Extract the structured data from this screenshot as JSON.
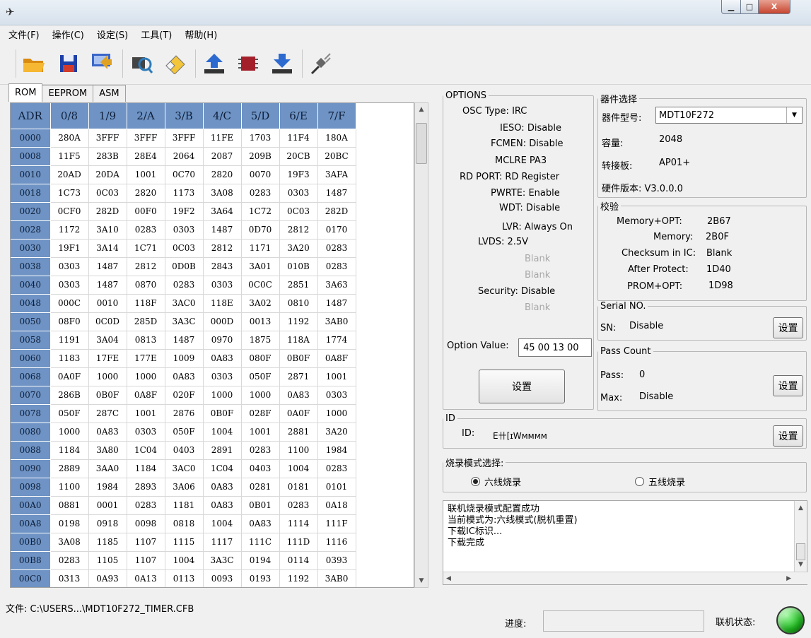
{
  "window": {
    "app_icon": "tool-icon",
    "btn_min": "▁",
    "btn_max": "□",
    "btn_close": "X"
  },
  "menu": [
    "文件(F)",
    "操作(C)",
    "设定(S)",
    "工具(T)",
    "帮助(H)"
  ],
  "toolbar_icons": [
    "open-folder-icon",
    "save-icon",
    "save-as-icon",
    "search-chip-icon",
    "erase-icon",
    "upload-icon",
    "chip-icon",
    "download-icon",
    "connect-plug-icon"
  ],
  "tabs": [
    "ROM",
    "EEPROM",
    "ASM"
  ],
  "rom": {
    "columns": [
      "ADR",
      "0/8",
      "1/9",
      "2/A",
      "3/B",
      "4/C",
      "5/D",
      "6/E",
      "7/F"
    ],
    "rows": [
      [
        "0000",
        "280A",
        "3FFF",
        "3FFF",
        "3FFF",
        "11FE",
        "1703",
        "11F4",
        "180A"
      ],
      [
        "0008",
        "11F5",
        "283B",
        "28E4",
        "2064",
        "2087",
        "209B",
        "20CB",
        "20BC"
      ],
      [
        "0010",
        "20AD",
        "20DA",
        "1001",
        "0C70",
        "2820",
        "0070",
        "19F3",
        "3AFA"
      ],
      [
        "0018",
        "1C73",
        "0C03",
        "2820",
        "1173",
        "3A08",
        "0283",
        "0303",
        "1487"
      ],
      [
        "0020",
        "0CF0",
        "282D",
        "00F0",
        "19F2",
        "3A64",
        "1C72",
        "0C03",
        "282D"
      ],
      [
        "0028",
        "1172",
        "3A10",
        "0283",
        "0303",
        "1487",
        "0D70",
        "2812",
        "0170"
      ],
      [
        "0030",
        "19F1",
        "3A14",
        "1C71",
        "0C03",
        "2812",
        "1171",
        "3A20",
        "0283"
      ],
      [
        "0038",
        "0303",
        "1487",
        "2812",
        "0D0B",
        "2843",
        "3A01",
        "010B",
        "0283"
      ],
      [
        "0040",
        "0303",
        "1487",
        "0870",
        "0283",
        "0303",
        "0C0C",
        "2851",
        "3A63"
      ],
      [
        "0048",
        "000C",
        "0010",
        "118F",
        "3AC0",
        "118E",
        "3A02",
        "0810",
        "1487"
      ],
      [
        "0050",
        "08F0",
        "0C0D",
        "285D",
        "3A3C",
        "000D",
        "0013",
        "1192",
        "3AB0"
      ],
      [
        "0058",
        "1191",
        "3A04",
        "0813",
        "1487",
        "0970",
        "1875",
        "118A",
        "1774"
      ],
      [
        "0060",
        "1183",
        "17FE",
        "177E",
        "1009",
        "0A83",
        "080F",
        "0B0F",
        "0A8F"
      ],
      [
        "0068",
        "0A0F",
        "1000",
        "1000",
        "0A83",
        "0303",
        "050F",
        "2871",
        "1001"
      ],
      [
        "0070",
        "286B",
        "0B0F",
        "0A8F",
        "020F",
        "1000",
        "1000",
        "0A83",
        "0303"
      ],
      [
        "0078",
        "050F",
        "287C",
        "1001",
        "2876",
        "0B0F",
        "028F",
        "0A0F",
        "1000"
      ],
      [
        "0080",
        "1000",
        "0A83",
        "0303",
        "050F",
        "1004",
        "1001",
        "2881",
        "3A20"
      ],
      [
        "0088",
        "1184",
        "3A80",
        "1C04",
        "0403",
        "2891",
        "0283",
        "1100",
        "1984"
      ],
      [
        "0090",
        "2889",
        "3AA0",
        "1184",
        "3AC0",
        "1C04",
        "0403",
        "1004",
        "0283"
      ],
      [
        "0098",
        "1100",
        "1984",
        "2893",
        "3A06",
        "0A83",
        "0281",
        "0181",
        "0101"
      ],
      [
        "00A0",
        "0881",
        "0001",
        "0283",
        "1181",
        "0A83",
        "0B01",
        "0283",
        "0A18"
      ],
      [
        "00A8",
        "0198",
        "0918",
        "0098",
        "0818",
        "1004",
        "0A83",
        "1114",
        "111F"
      ],
      [
        "00B0",
        "3A08",
        "1185",
        "1107",
        "1115",
        "1117",
        "111C",
        "111D",
        "1116"
      ],
      [
        "00B8",
        "0283",
        "1105",
        "1107",
        "1004",
        "3A3C",
        "0194",
        "0114",
        "0393"
      ],
      [
        "00C0",
        "0313",
        "0A93",
        "0A13",
        "0113",
        "0093",
        "0193",
        "1192",
        "3AB0"
      ]
    ]
  },
  "file_path": "文件: C:\\USERS...\\MDT10F272_TIMER.CFB",
  "options": {
    "legend": "OPTIONS",
    "osc_type": "OSC Type: IRC",
    "ieso": "IESO: Disable",
    "fcmen": "FCMEN: Disable",
    "mclre": "MCLRE PA3",
    "rd_port": "RD PORT: RD Register",
    "pwrte": "PWRTE: Enable",
    "wdt": "WDT: Disable",
    "lvr": "LVR: Always On",
    "lvds": "LVDS: 2.5V",
    "blank1": "Blank",
    "blank2": "Blank",
    "security": "Security: Disable",
    "blank3": "Blank",
    "option_value_label": "Option Value:",
    "option_value": "45 00 13 00",
    "set_label": "设置"
  },
  "device": {
    "legend": "器件选择",
    "model_label": "器件型号:",
    "model_value": "MDT10F272",
    "capacity_label": "容量:",
    "capacity_value": "2048",
    "adapter_label": "转接板:",
    "adapter_value": "AP01+",
    "hw_version": "硬件版本: V3.0.0.0"
  },
  "checksum": {
    "legend": "校验",
    "mem_opt_label": "Memory+OPT:",
    "mem_opt_value": "2B67",
    "memory_label": "Memory:",
    "memory_value": "2B0F",
    "in_ic_label": "Checksum in IC:",
    "in_ic_value": "Blank",
    "after_label": "After Protect:",
    "after_value": "1D40",
    "prom_label": "PROM+OPT:",
    "prom_value": "1D98"
  },
  "serial": {
    "legend": "Serial NO.",
    "sn_label": "SN:",
    "sn_value": "Disable",
    "set_label": "设置"
  },
  "pass": {
    "legend": "Pass Count",
    "pass_label": "Pass:",
    "pass_value": "0",
    "max_label": "Max:",
    "max_value": "Disable",
    "set_label": "设置"
  },
  "id": {
    "legend": "ID",
    "id_label": "ID:",
    "id_value": "E卄[ɪWᴍᴍᴍᴍ",
    "set_label": "设置"
  },
  "burn_mode": {
    "legend": "烧录模式选择:",
    "six_wire": "六线烧录",
    "five_wire": "五线烧录",
    "selected": "six"
  },
  "log": [
    "联机烧录模式配置成功",
    "当前模式为:六线模式(脱机重置)",
    "下载IC标识...",
    "下载完成"
  ],
  "status": {
    "progress_label": "进度:",
    "progress": 0,
    "online_label": "联机状态:",
    "online_color": "#22c322"
  }
}
